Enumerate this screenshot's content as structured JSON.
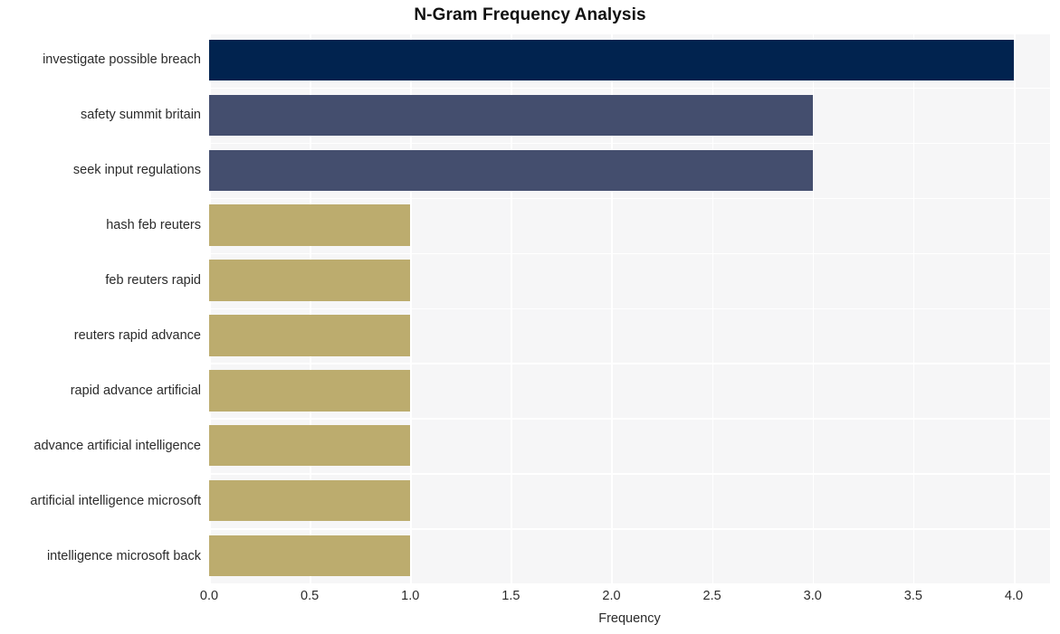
{
  "chart_data": {
    "type": "bar",
    "orientation": "horizontal",
    "title": "N-Gram Frequency Analysis",
    "xlabel": "Frequency",
    "ylabel": "",
    "xlim": [
      0,
      4.18
    ],
    "xticks": [
      0,
      0.5,
      1,
      1.5,
      2,
      2.5,
      3,
      3.5,
      4
    ],
    "xtick_labels": [
      "0.0",
      "0.5",
      "1.0",
      "1.5",
      "2.0",
      "2.5",
      "3.0",
      "3.5",
      "4.0"
    ],
    "grid": true,
    "legend": false,
    "categories": [
      "investigate possible breach",
      "safety summit britain",
      "seek input regulations",
      "hash feb reuters",
      "feb reuters rapid",
      "reuters rapid advance",
      "rapid advance artificial",
      "advance artificial intelligence",
      "artificial intelligence microsoft",
      "intelligence microsoft back"
    ],
    "values": [
      4,
      3,
      3,
      1,
      1,
      1,
      1,
      1,
      1,
      1
    ],
    "bar_colors": [
      "#01234f",
      "#444e6e",
      "#444e6e",
      "#bcac6e",
      "#bcac6e",
      "#bcac6e",
      "#bcac6e",
      "#bcac6e",
      "#bcac6e",
      "#bcac6e"
    ],
    "plot_background": "#f6f6f7",
    "grid_color": "#ffffff",
    "text_color": "#2b2b2b",
    "title_color": "#111111"
  }
}
